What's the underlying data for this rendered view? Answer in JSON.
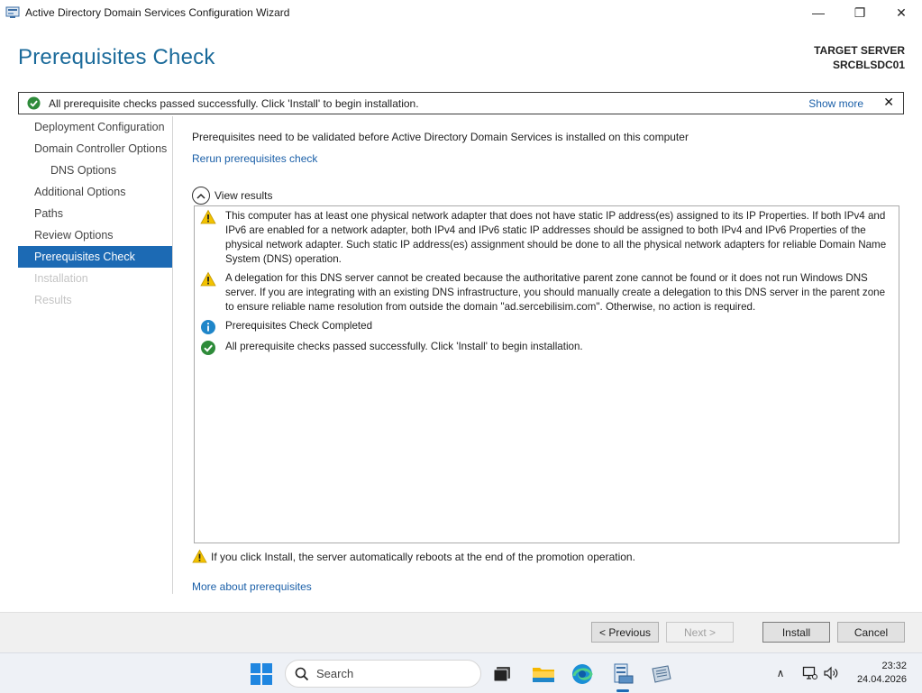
{
  "window": {
    "title": "Active Directory Domain Services Configuration Wizard",
    "minimize_glyph": "—",
    "maximize_glyph": "❐",
    "close_glyph": "✕"
  },
  "header": {
    "page_title": "Prerequisites Check",
    "target_label": "TARGET SERVER",
    "target_server": "SRCBLSDC01"
  },
  "notification": {
    "message": "All prerequisite checks passed successfully.  Click 'Install' to begin installation.",
    "show_more": "Show more",
    "close_glyph": "✕"
  },
  "sidebar": {
    "items": [
      {
        "label": "Deployment Configuration",
        "state": "normal"
      },
      {
        "label": "Domain Controller Options",
        "state": "normal"
      },
      {
        "label": "DNS Options",
        "state": "sub"
      },
      {
        "label": "Additional Options",
        "state": "normal"
      },
      {
        "label": "Paths",
        "state": "normal"
      },
      {
        "label": "Review Options",
        "state": "normal"
      },
      {
        "label": "Prerequisites Check",
        "state": "active"
      },
      {
        "label": "Installation",
        "state": "disabled"
      },
      {
        "label": "Results",
        "state": "disabled"
      }
    ]
  },
  "main": {
    "intro": "Prerequisites need to be validated before Active Directory Domain Services is installed on this computer",
    "rerun_link": "Rerun prerequisites check",
    "view_results": "View results",
    "results": [
      {
        "icon": "warning-icon",
        "text": "This computer has at least one physical network adapter that does not have static IP address(es) assigned to its IP Properties. If both IPv4 and IPv6 are enabled for a network adapter, both IPv4 and IPv6 static IP addresses should be assigned to both IPv4 and IPv6 Properties of the physical network adapter. Such static IP address(es) assignment should be done to all the physical network adapters for reliable Domain Name System (DNS) operation."
      },
      {
        "icon": "warning-icon",
        "text": "A delegation for this DNS server cannot be created because the authoritative parent zone cannot be found or it does not run Windows DNS server. If you are integrating with an existing DNS infrastructure, you should manually create a delegation to this DNS server in the parent zone to ensure reliable name resolution from outside the domain \"ad.sercebilisim.com\". Otherwise, no action is required."
      },
      {
        "icon": "info-icon",
        "text": "Prerequisites Check Completed"
      },
      {
        "icon": "success-icon",
        "text": "All prerequisite checks passed successfully.  Click 'Install' to begin installation."
      }
    ],
    "footer_warning": "If you click Install, the server automatically reboots at the end of the promotion operation.",
    "more_link": "More about prerequisites"
  },
  "buttons": {
    "previous": "< Previous",
    "next": "Next >",
    "install": "Install",
    "cancel": "Cancel"
  },
  "taskbar": {
    "search_label": "Search",
    "time": "23:32",
    "date": "24.04.2026",
    "chevron_glyph": "∧"
  },
  "colors": {
    "accent": "#1c6ab4",
    "title_blue": "#1a6a9a",
    "link": "#1a5fa8",
    "warning": "#f2c200",
    "success": "#2e8b3a",
    "info": "#1f86c9"
  }
}
